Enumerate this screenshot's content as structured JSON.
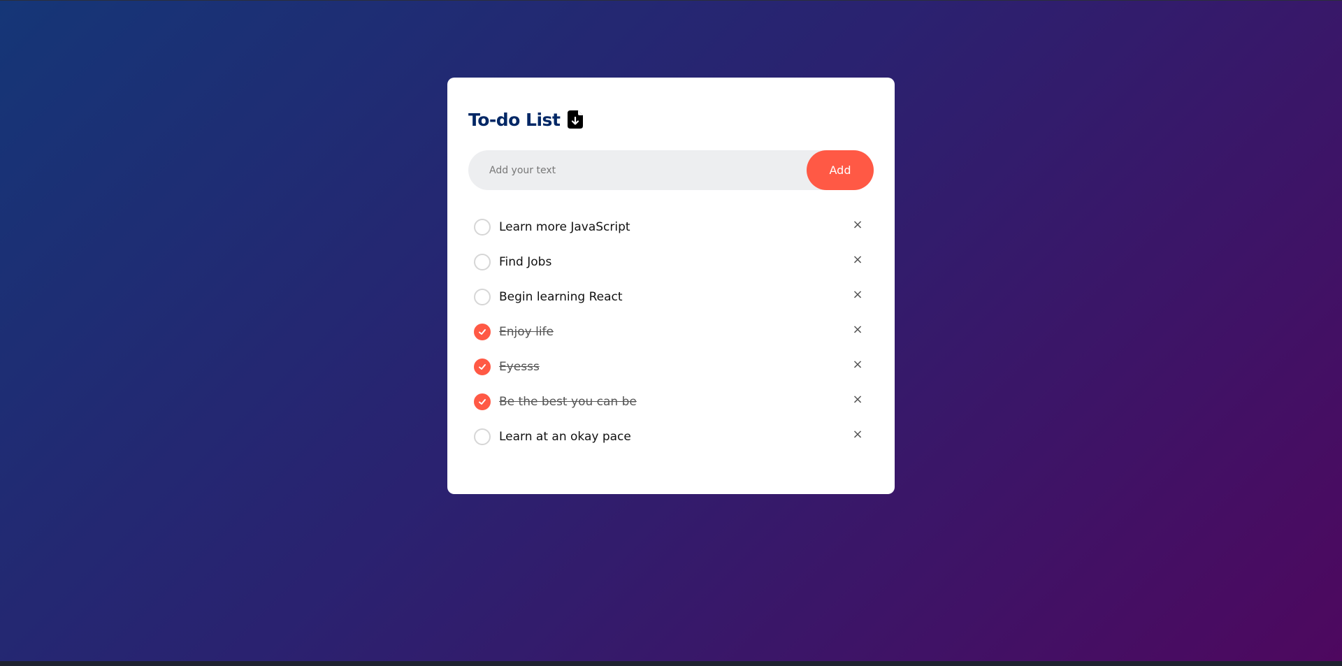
{
  "app": {
    "title": "To-do List",
    "title_icon": "file-download-icon"
  },
  "input": {
    "placeholder": "Add your text",
    "value": ""
  },
  "add_button": {
    "label": "Add"
  },
  "colors": {
    "accent": "#ff5945",
    "title": "#002765",
    "input_bg": "#edeef0",
    "gradient_start": "#153677",
    "gradient_end": "#4e085f"
  },
  "tasks": [
    {
      "text": "Learn more JavaScript",
      "checked": false,
      "remove": "×"
    },
    {
      "text": "Find Jobs",
      "checked": false,
      "remove": "×"
    },
    {
      "text": "Begin learning React",
      "checked": false,
      "remove": "×"
    },
    {
      "text": "Enjoy life",
      "checked": true,
      "remove": "×"
    },
    {
      "text": "Eyesss",
      "checked": true,
      "remove": "×"
    },
    {
      "text": "Be the best you can be",
      "checked": true,
      "remove": "×"
    },
    {
      "text": "Learn at an okay pace",
      "checked": false,
      "remove": "×"
    }
  ]
}
